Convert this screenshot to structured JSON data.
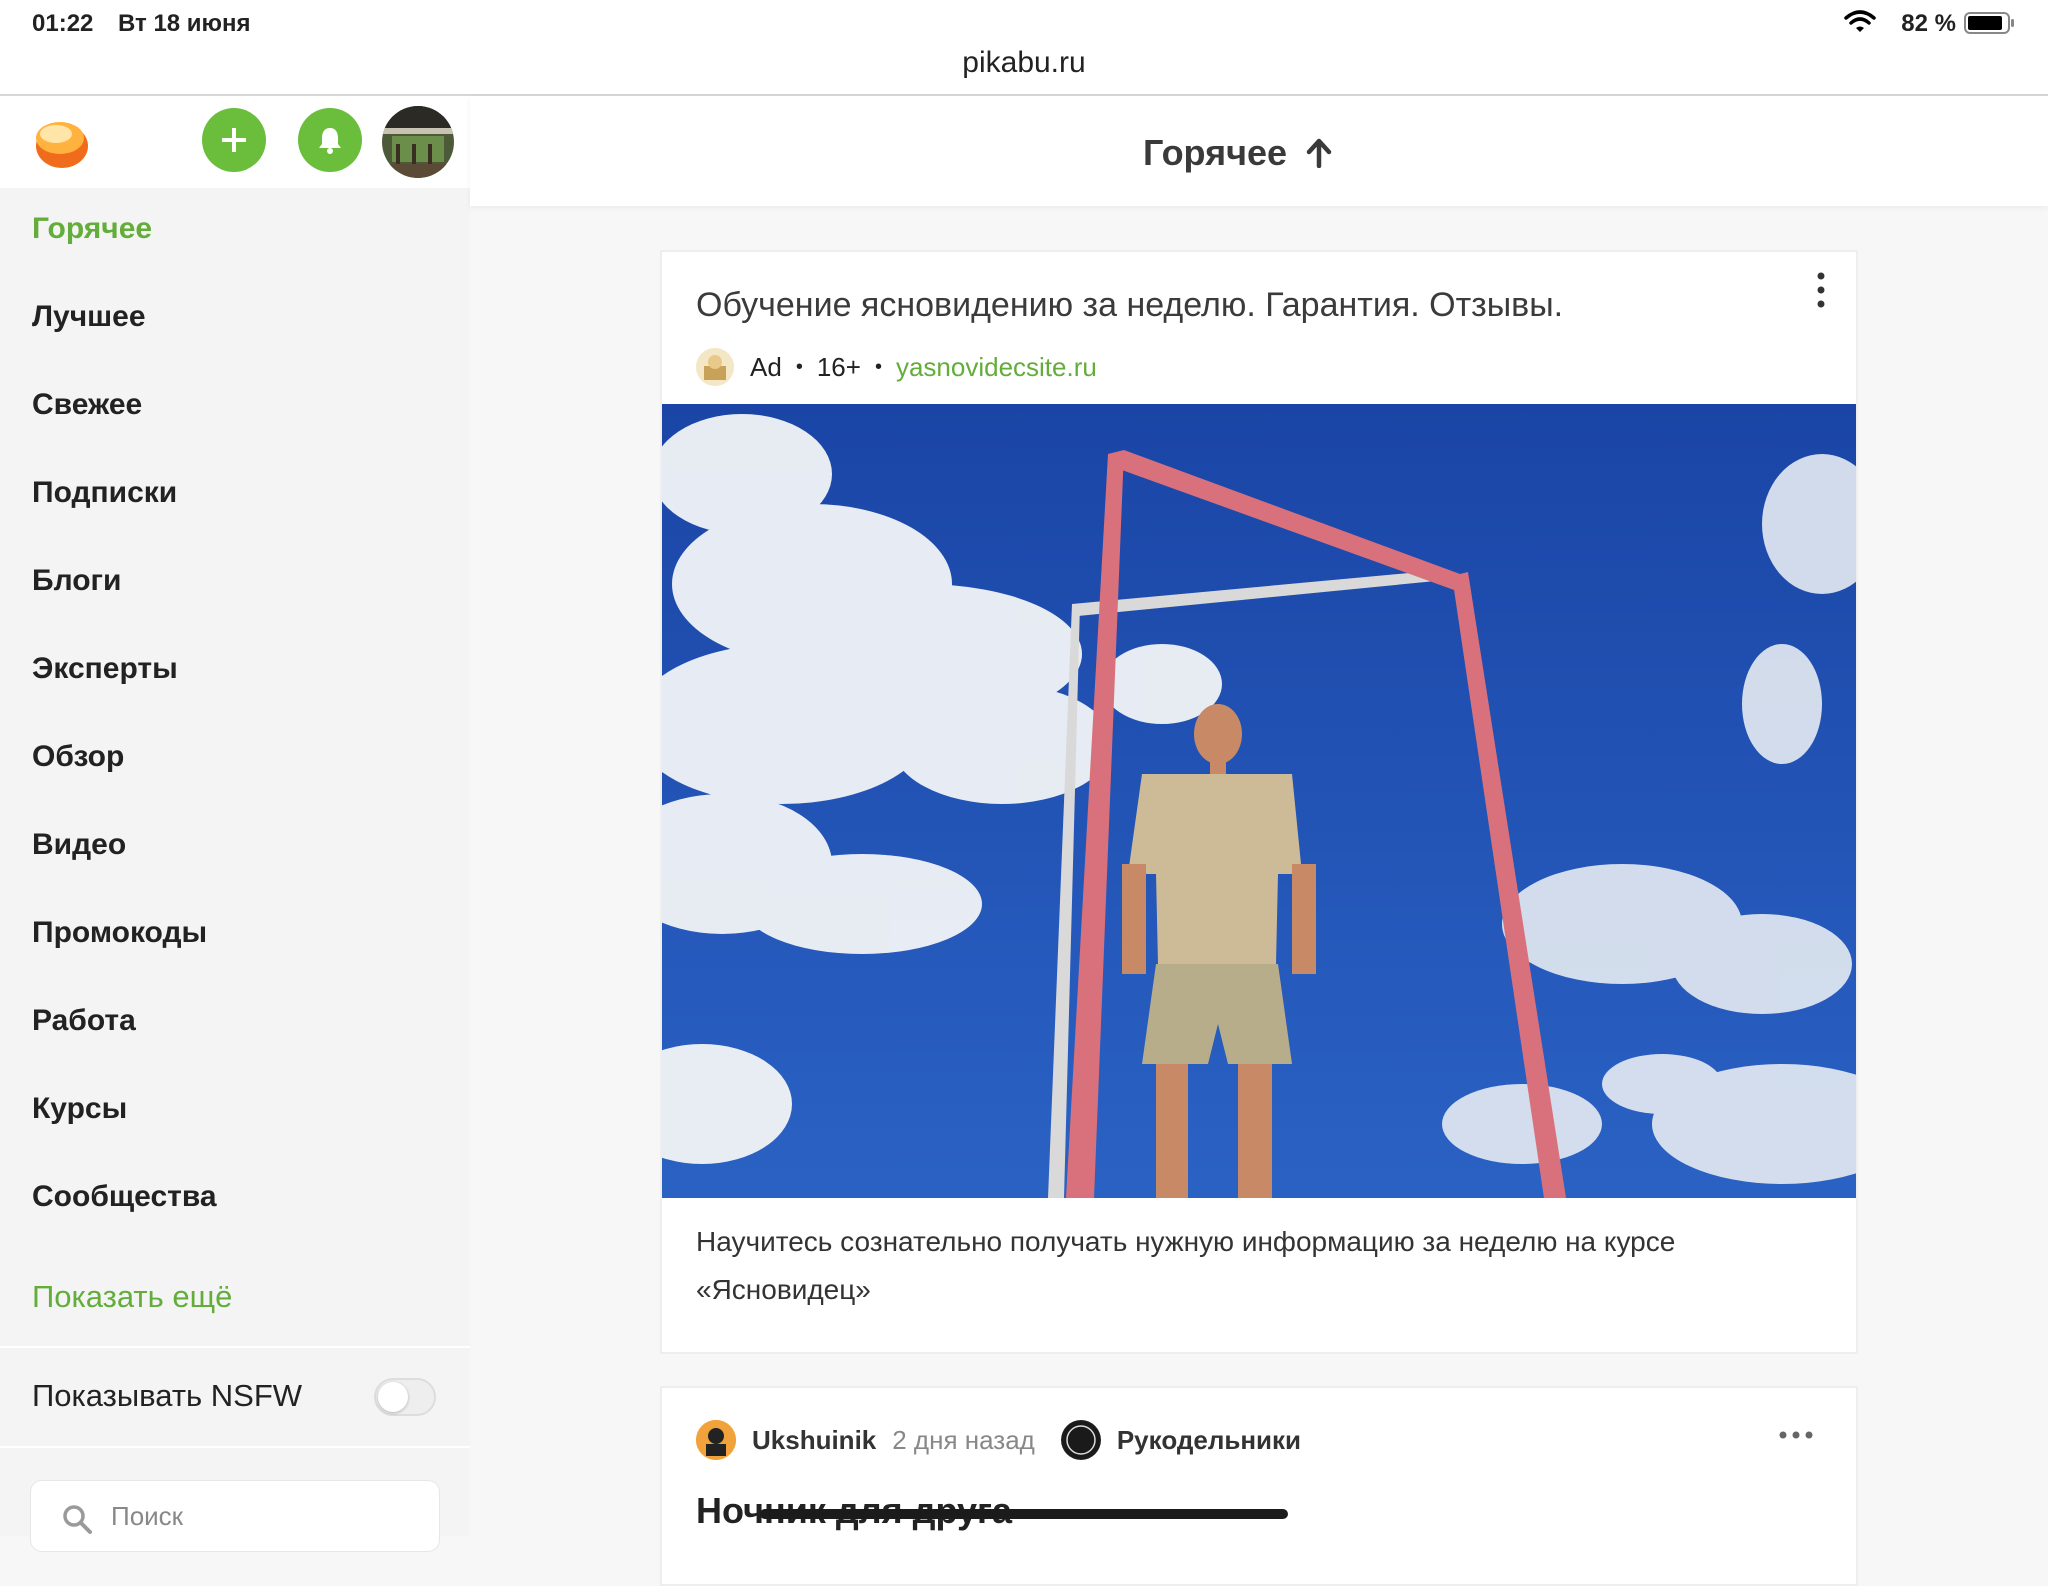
{
  "status_bar": {
    "time": "01:22",
    "date": "Вт 18 июня",
    "url": "pikabu.ru",
    "battery": "82 %"
  },
  "sidebar": {
    "nav": [
      {
        "label": "Горячее",
        "active": true
      },
      {
        "label": "Лучшее"
      },
      {
        "label": "Свежее"
      },
      {
        "label": "Подписки"
      },
      {
        "label": "Блоги"
      },
      {
        "label": "Эксперты"
      },
      {
        "label": "Обзор"
      },
      {
        "label": "Видео"
      },
      {
        "label": "Промокоды"
      },
      {
        "label": "Работа"
      },
      {
        "label": "Курсы"
      },
      {
        "label": "Сообщества"
      }
    ],
    "show_more": "Показать ещё",
    "nsfw_label": "Показывать NSFW",
    "nsfw_enabled": false,
    "search_placeholder": "Поиск"
  },
  "header": {
    "sort_title": "Горячее",
    "sort_icon": "arrow-up-icon"
  },
  "ad": {
    "title": "Обучение ясновидению за неделю. Гарантия. Отзывы.",
    "label": "Ad",
    "age": "16+",
    "domain": "yasnovidecsite.ru",
    "description": "Научитесь сознательно получать нужную информацию за неделю на курсе «Ясновидец»"
  },
  "post": {
    "author": "Ukshuinik",
    "time": "2 дня назад",
    "community": "Рукодельники",
    "title": "Ночник для друга"
  },
  "colors": {
    "accent": "#63ad3a",
    "button_green": "#6abe3b",
    "sky": "#1f4fae"
  }
}
